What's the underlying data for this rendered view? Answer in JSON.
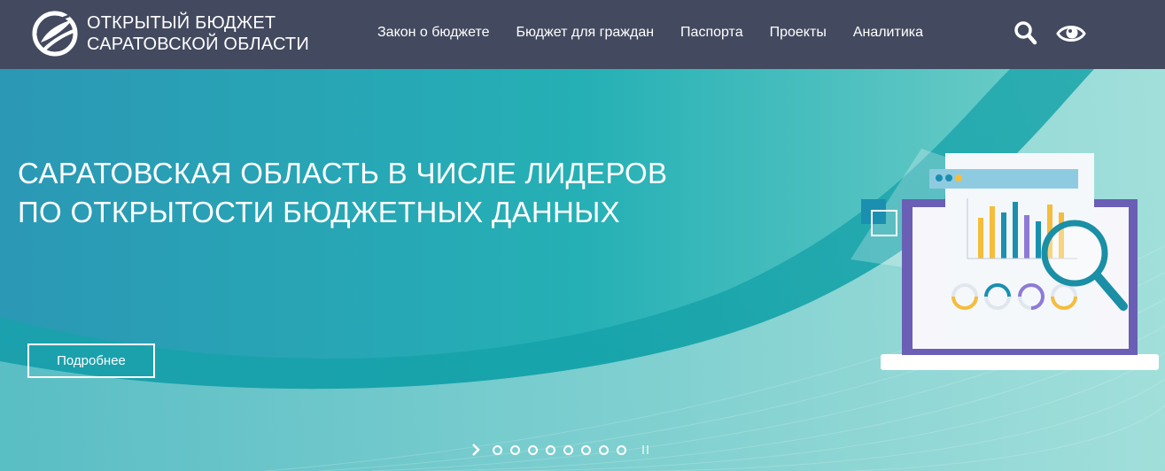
{
  "header": {
    "logo": {
      "line1": "ОТКРЫТЫЙ БЮДЖЕТ",
      "line2": "САРАТОВСКОЙ ОБЛАСТИ"
    },
    "nav": [
      {
        "label": "Закон о бюджете"
      },
      {
        "label": "Бюджет для граждан"
      },
      {
        "label": "Паспорта"
      },
      {
        "label": "Проекты"
      },
      {
        "label": "Аналитика"
      }
    ],
    "icons": {
      "search": "search-icon",
      "accessibility": "eye-icon"
    }
  },
  "hero": {
    "title_line1": "САРАТОВСКАЯ ОБЛАСТЬ В ЧИСЛЕ ЛИДЕРОВ",
    "title_line2": "ПО ОТКРЫТОСТИ БЮДЖЕТНЫХ ДАННЫХ",
    "button_label": "Подробнее",
    "slides_count": 8
  },
  "colors": {
    "header_bg": "#434a5f",
    "hero_teal": "#2ba6b6",
    "accent_purple": "#6a5fb5",
    "accent_yellow": "#f5bd3c"
  }
}
